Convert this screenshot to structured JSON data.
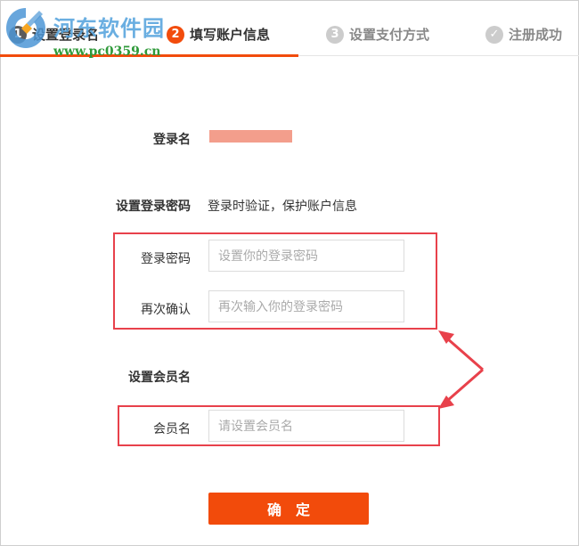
{
  "steps": [
    {
      "number": "1",
      "label": "设置登录名",
      "state": "done"
    },
    {
      "number": "2",
      "label": "填写账户信息",
      "state": "active"
    },
    {
      "number": "3",
      "label": "设置支付方式",
      "state": "todo"
    },
    {
      "number": "✓",
      "label": "注册成功",
      "state": "todo"
    }
  ],
  "watermark": {
    "title": "河东软件园",
    "url": "www.pc0359.cn"
  },
  "form": {
    "username_label": "登录名",
    "password_section_label": "设置登录密码",
    "password_hint": "登录时验证，保护账户信息",
    "password_label": "登录密码",
    "password_placeholder": "设置你的登录密码",
    "confirm_label": "再次确认",
    "confirm_placeholder": "再次输入你的登录密码",
    "member_section_label": "设置会员名",
    "member_label": "会员名",
    "member_placeholder": "请设置会员名",
    "submit_label": "确定"
  },
  "colors": {
    "accent": "#f24c0c",
    "highlight": "#e8414b",
    "redacted": "#f39e8c"
  }
}
